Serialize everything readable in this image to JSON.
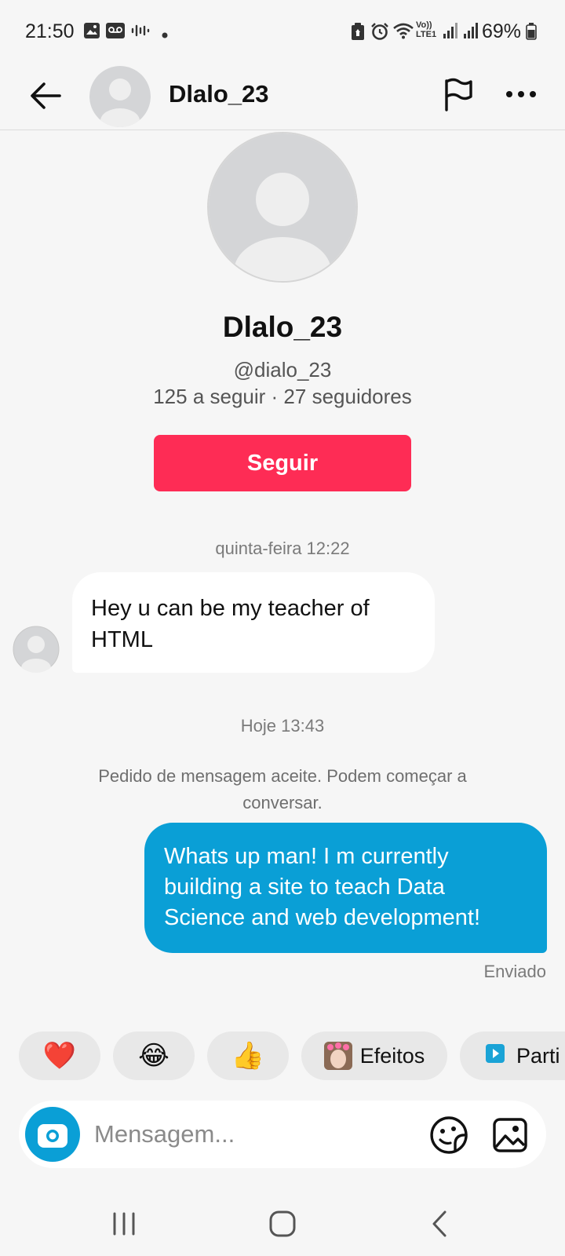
{
  "status_bar": {
    "time": "21:50",
    "battery": "69%",
    "icons": [
      "gallery-icon",
      "voicemail-icon",
      "audio-wave-icon",
      "dot-icon",
      "battery-saver-icon",
      "alarm-icon",
      "wifi-icon",
      "volte-icon",
      "signal-icon",
      "signal-icon",
      "battery-icon"
    ],
    "volte_label": "Vo)) LTE1"
  },
  "header": {
    "name": "Dlalo_23"
  },
  "profile": {
    "name": "Dlalo_23",
    "handle": "@dialo_23",
    "stats": "125 a seguir · 27 seguidores",
    "follow_label": "Seguir"
  },
  "chat": {
    "timestamp_1": "quinta-feira 12:22",
    "incoming_message": "Hey u can be my teacher of HTML",
    "timestamp_2": "Hoje 13:43",
    "system_notice": "Pedido de mensagem aceite. Podem começar a conversar.",
    "outgoing_message": "Whats up man! I m currently building a site to teach Data Science and web development!",
    "sent_status": "Enviado"
  },
  "quick_actions": {
    "heart": "❤️",
    "laugh": "😂",
    "thumbs_up": "👍",
    "effects_label": "Efeitos",
    "share_label": "Parti"
  },
  "composer": {
    "placeholder": "Mensagem..."
  },
  "colors": {
    "accent_red": "#fe2c55",
    "bubble_blue": "#0a9fd6",
    "background": "#f6f6f6"
  }
}
